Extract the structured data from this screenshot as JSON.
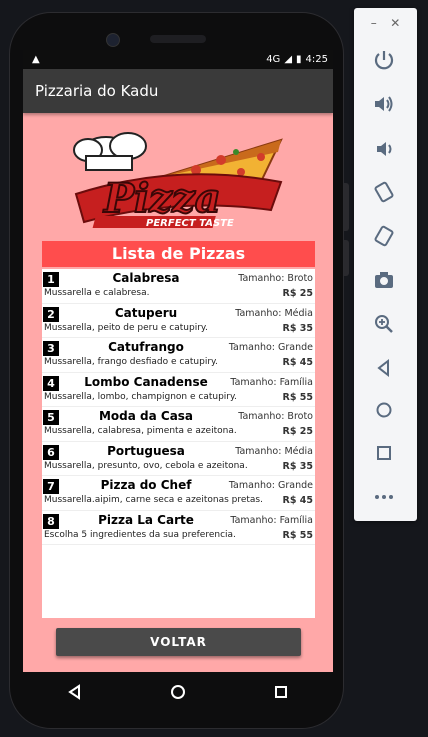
{
  "status": {
    "time": "4:25",
    "network": "4G"
  },
  "app": {
    "title": "Pizzaria do Kadu"
  },
  "logo": {
    "text": "Pizza",
    "tagline": "PERFECT TASTE"
  },
  "list": {
    "header": "Lista de Pizzas",
    "items": [
      {
        "num": "1",
        "name": "Calabresa",
        "size": "Tamanho: Broto",
        "desc": "Mussarella e calabresa.",
        "price": "R$ 25"
      },
      {
        "num": "2",
        "name": "Catuperu",
        "size": "Tamanho: Média",
        "desc": "Mussarella, peito de peru e catupiry.",
        "price": "R$ 35"
      },
      {
        "num": "3",
        "name": "Catufrango",
        "size": "Tamanho: Grande",
        "desc": "Mussarella, frango desfiado e catupiry.",
        "price": "R$ 45"
      },
      {
        "num": "4",
        "name": "Lombo Canadense",
        "size": "Tamanho: Família",
        "desc": "Mussarella, lombo, champignon e catupiry.",
        "price": "R$ 55"
      },
      {
        "num": "5",
        "name": "Moda da Casa",
        "size": "Tamanho: Broto",
        "desc": "Mussarella, calabresa, pimenta e azeitona.",
        "price": "R$ 25"
      },
      {
        "num": "6",
        "name": "Portuguesa",
        "size": "Tamanho: Média",
        "desc": "Mussarella, presunto, ovo, cebola e azeitona.",
        "price": "R$ 35"
      },
      {
        "num": "7",
        "name": "Pizza do Chef",
        "size": "Tamanho: Grande",
        "desc": "Mussarella.aipim, carne seca e azeitonas pretas.",
        "price": "R$ 45"
      },
      {
        "num": "8",
        "name": "Pizza La Carte",
        "size": "Tamanho: Família",
        "desc": "Escolha 5 ingredientes da sua preferencia.",
        "price": "R$ 55"
      }
    ]
  },
  "buttons": {
    "voltar": "VOLTAR"
  },
  "colors": {
    "screen_bg": "#ffa8a8",
    "header_bg": "#ff4d4d",
    "appbar_bg": "#3a3a3a"
  },
  "emulator_toolbar": {
    "items": [
      "power-icon",
      "volume-up-icon",
      "volume-down-icon",
      "rotate-left-icon",
      "rotate-right-icon",
      "camera-icon",
      "zoom-icon",
      "back-icon",
      "home-icon",
      "overview-icon",
      "more-icon"
    ]
  }
}
